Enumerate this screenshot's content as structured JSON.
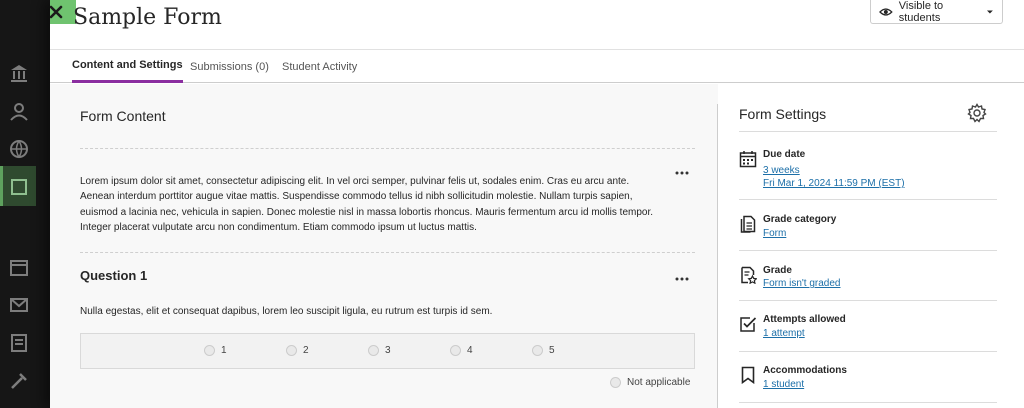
{
  "header": {
    "title": "Sample Form",
    "visibility_label": "Visible to students"
  },
  "tabs": [
    {
      "label": "Content and Settings"
    },
    {
      "label": "Submissions (0)"
    },
    {
      "label": "Student Activity"
    }
  ],
  "content": {
    "section_title": "Form Content",
    "text_block": "Lorem ipsum dolor sit amet, consectetur adipiscing elit. In vel orci semper, pulvinar felis ut, sodales enim. Cras eu arcu ante. Aenean interdum porttitor augue vitae mattis. Suspendisse commodo tellus id nibh sollicitudin molestie. Nullam turpis sapien, euismod a lacinia nec, vehicula in sapien. Donec molestie nisl in massa lobortis rhoncus. Mauris fermentum arcu id mollis tempor. Integer placerat vulputate arcu non condimentum. Etiam commodo ipsum ut luctus mattis.",
    "question": {
      "title": "Question 1",
      "text": "Nulla egestas, elit et consequat dapibus, lorem leo suscipit ligula, eu rutrum est turpis id sem.",
      "options": [
        "1",
        "2",
        "3",
        "4",
        "5"
      ],
      "not_applicable": "Not applicable"
    }
  },
  "settings": {
    "title": "Form Settings",
    "due_date": {
      "label": "Due date",
      "relative": "3 weeks",
      "date": "Fri Mar 1, 2024 11:59 PM (EST)"
    },
    "grade_category": {
      "label": "Grade category",
      "value": "Form"
    },
    "grade": {
      "label": "Grade",
      "value": "Form isn't graded"
    },
    "attempts": {
      "label": "Attempts allowed",
      "value": "1 attempt"
    },
    "accommodations": {
      "label": "Accommodations",
      "value": "1 student"
    }
  },
  "colors": {
    "tab_accent": "#8b2ea0",
    "link": "#1c6fa8",
    "close_button": "#6fc36f"
  },
  "icons": {
    "close": "close-icon",
    "visibility": "eye-icon",
    "settings": "gear-icon",
    "due_date": "calendar-icon",
    "grade_category": "document-icon",
    "grade": "grade-star-icon",
    "attempts": "checkbox-icon",
    "accommodations": "bookmark-icon"
  }
}
